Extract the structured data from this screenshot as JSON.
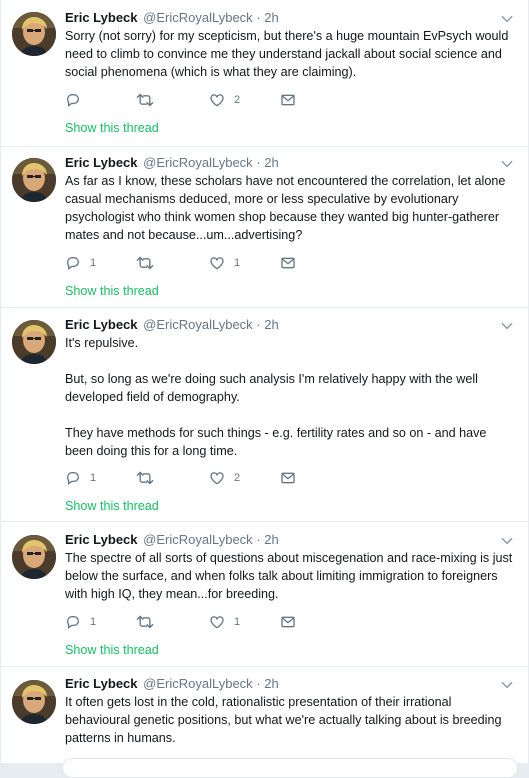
{
  "colors": {
    "accent": "#1da1f2",
    "thread_link": "#17bf63",
    "muted": "#657786",
    "text": "#14171a"
  },
  "tweets": [
    {
      "name": "Eric Lybeck",
      "handle": "@EricRoyalLybeck",
      "sep": "·",
      "time": "2h",
      "body": [
        "Sorry (not sorry) for my scepticism, but there's a huge mountain EvPsych would need to climb to convince me they understand jackall about social science and social phenomena (which is what they are claiming)."
      ],
      "replies": "",
      "retweets": "",
      "likes": "2",
      "show_thread": "Show this thread"
    },
    {
      "name": "Eric Lybeck",
      "handle": "@EricRoyalLybeck",
      "sep": "·",
      "time": "2h",
      "body": [
        "As far as I know, these scholars have not encountered the correlation, let alone casual mechanisms deduced, more or less speculative by evolutionary psychologist who think women shop because they wanted big hunter-gatherer mates and not because...um...advertising?"
      ],
      "replies": "1",
      "retweets": "",
      "likes": "1",
      "show_thread": "Show this thread"
    },
    {
      "name": "Eric Lybeck",
      "handle": "@EricRoyalLybeck",
      "sep": "·",
      "time": "2h",
      "body": [
        "It's repulsive.",
        "But, so long as we're doing such analysis I'm relatively happy with the well developed field of demography.",
        "They have methods for such things - e.g. fertility rates and so on - and have been doing this for a long time."
      ],
      "replies": "1",
      "retweets": "",
      "likes": "2",
      "show_thread": "Show this thread"
    },
    {
      "name": "Eric Lybeck",
      "handle": "@EricRoyalLybeck",
      "sep": "·",
      "time": "2h",
      "body": [
        "The spectre of all sorts of questions about miscegenation and race-mixing is just below the surface, and when folks talk about limiting immigration to foreigners with high IQ, they mean...for breeding."
      ],
      "replies": "1",
      "retweets": "",
      "likes": "1",
      "show_thread": "Show this thread"
    },
    {
      "name": "Eric Lybeck",
      "handle": "@EricRoyalLybeck",
      "sep": "·",
      "time": "2h",
      "body": [
        "It often gets lost in the cold, rationalistic presentation of their irrational behavioural genetic positions, but what we're actually talking about is breeding patterns in humans."
      ]
    }
  ]
}
